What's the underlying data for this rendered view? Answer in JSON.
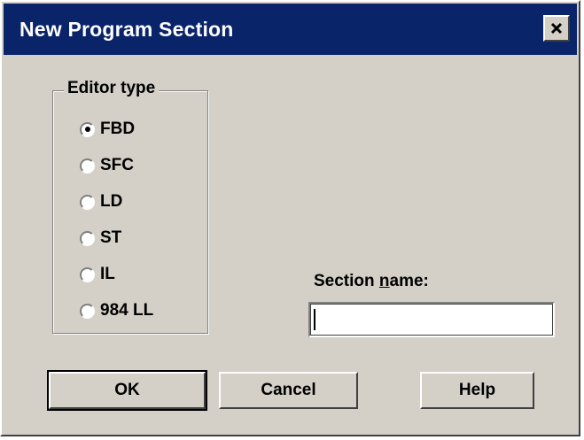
{
  "window": {
    "title": "New Program Section",
    "close_glyph": "✕"
  },
  "editor_type": {
    "label": "Editor type",
    "selected": "FBD",
    "options": [
      {
        "label": "FBD",
        "checked": true
      },
      {
        "label": "SFC",
        "checked": false
      },
      {
        "label": "LD",
        "checked": false
      },
      {
        "label": "ST",
        "checked": false
      },
      {
        "label": "IL",
        "checked": false
      },
      {
        "label": "984 LL",
        "checked": false
      }
    ]
  },
  "section_name": {
    "label_prefix": "Section ",
    "label_mnemonic": "n",
    "label_suffix": "ame:",
    "value": ""
  },
  "buttons": {
    "ok": "OK",
    "cancel": "Cancel",
    "help": "Help"
  },
  "colors": {
    "titlebar": "#0a246a",
    "face": "#d4d0c8"
  }
}
